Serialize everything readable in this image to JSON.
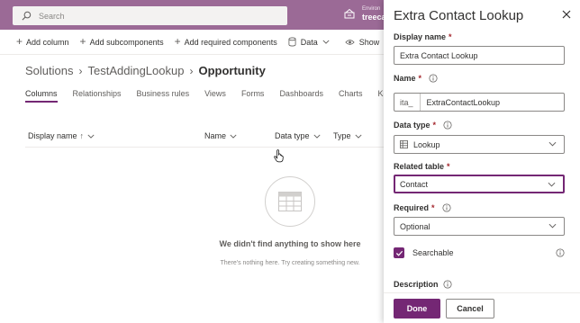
{
  "header": {
    "search_placeholder": "Search",
    "environment_label": "Environ",
    "environment_value": "treeca"
  },
  "commands": {
    "add_column": "Add column",
    "add_subcomponents": "Add subcomponents",
    "add_required": "Add required components",
    "data": "Data",
    "show": "Show"
  },
  "breadcrumb": {
    "solutions": "Solutions",
    "solution": "TestAddingLookup",
    "current": "Opportunity"
  },
  "tabs": [
    "Columns",
    "Relationships",
    "Business rules",
    "Views",
    "Forms",
    "Dashboards",
    "Charts",
    "Ke"
  ],
  "columns": {
    "display_name": "Display name",
    "display_name_sort": "↑",
    "name": "Name",
    "data_type": "Data type",
    "type": "Type"
  },
  "empty": {
    "title": "We didn't find anything to show here",
    "subtitle": "There's nothing here. Try creating something new."
  },
  "panel": {
    "title": "Extra Contact Lookup",
    "display_name_label": "Display name",
    "display_name_value": "Extra Contact Lookup",
    "name_label": "Name",
    "name_prefix": "ita_",
    "name_value": "ExtraContactLookup",
    "data_type_label": "Data type",
    "data_type_value": "Lookup",
    "related_table_label": "Related table",
    "related_table_value": "Contact",
    "required_label": "Required",
    "required_value": "Optional",
    "searchable_label": "Searchable",
    "description_label": "Description",
    "required_marker": "*",
    "done": "Done",
    "cancel": "Cancel"
  },
  "colors": {
    "header_bg": "#9b6a96",
    "accent": "#742774",
    "required": "#a4262c"
  }
}
